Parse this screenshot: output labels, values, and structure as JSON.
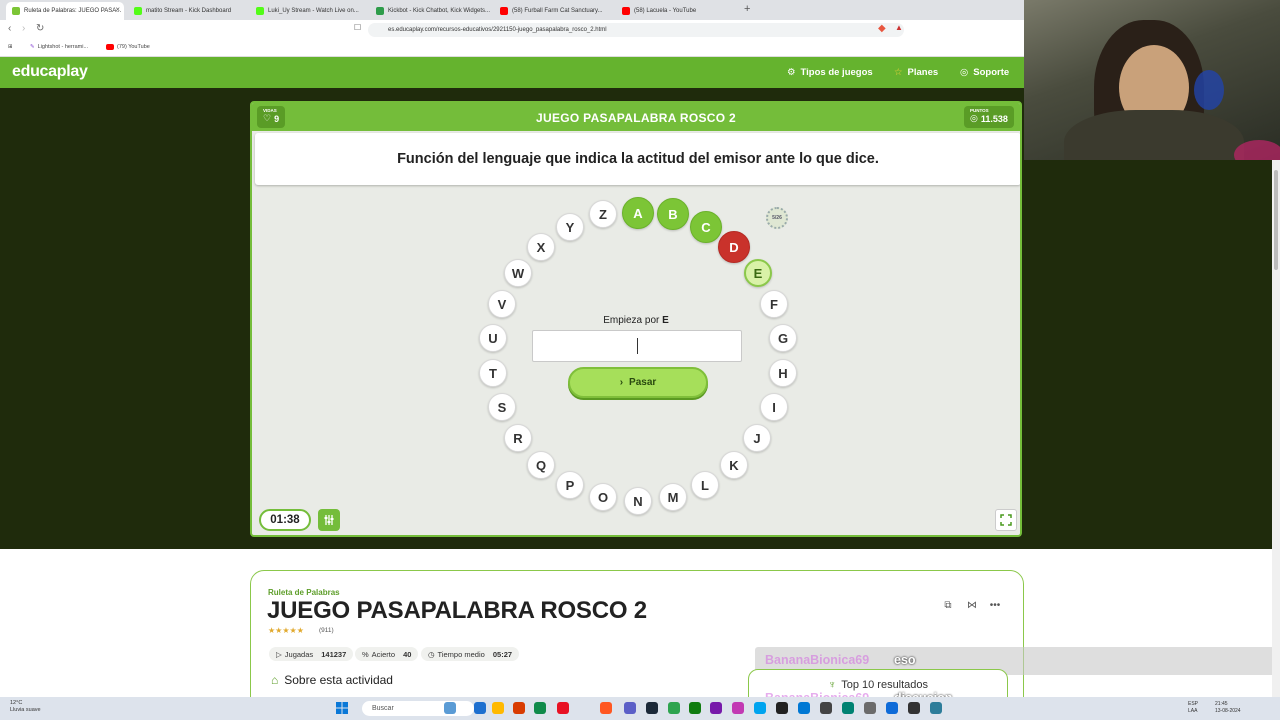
{
  "browser": {
    "tabs": [
      {
        "label": "Ruleta de Palabras: JUEGO PASA...",
        "active": true,
        "fav_color": "#7cc536"
      },
      {
        "label": "matito Stream - Kick Dashboard",
        "active": false,
        "fav_color": "#53fc18"
      },
      {
        "label": "Luki_Uy Stream - Watch Live on...",
        "active": false,
        "fav_color": "#53fc18"
      },
      {
        "label": "Kickbot - Kick Chatbot, Kick Widgets...",
        "active": false,
        "fav_color": "#2e9c4a"
      },
      {
        "label": "(58) Furball Farm Cat Sanctuary...",
        "active": false,
        "fav_color": "#ff0000"
      },
      {
        "label": "(58) Lacuela - YouTube",
        "active": false,
        "fav_color": "#ff0000"
      }
    ],
    "close_glyph": "×",
    "new_tab_glyph": "+",
    "url": "es.educaplay.com/recursos-educativos/2921150-juego_pasapalabra_rosco_2.html",
    "bookmarks": [
      "Lightshot - herrami...",
      "(79) YouTube"
    ]
  },
  "header": {
    "logo": "educaplay",
    "nav": [
      "Tipos de juegos",
      "Planes",
      "Soporte"
    ],
    "brand_color": "#65b32e"
  },
  "game": {
    "lives_label": "VIDAS",
    "lives": "9",
    "title": "JUEGO PASAPALABRA ROSCO 2",
    "points_label": "PUNTOS",
    "points": "11.538",
    "question": "Función del lenguaje que indica la actitud del emisor ante lo que dice.",
    "progress": "5/26",
    "prompt_text": "Empieza por",
    "prompt_letter": "E",
    "answer_value": "",
    "pass_label": "Pasar",
    "timer": "01:38",
    "letters": [
      {
        "letter": "A",
        "state": "correct"
      },
      {
        "letter": "B",
        "state": "correct"
      },
      {
        "letter": "C",
        "state": "correct"
      },
      {
        "letter": "D",
        "state": "wrong"
      },
      {
        "letter": "E",
        "state": "current"
      },
      {
        "letter": "F",
        "state": "pending"
      },
      {
        "letter": "G",
        "state": "pending"
      },
      {
        "letter": "H",
        "state": "pending"
      },
      {
        "letter": "I",
        "state": "pending"
      },
      {
        "letter": "J",
        "state": "pending"
      },
      {
        "letter": "K",
        "state": "pending"
      },
      {
        "letter": "L",
        "state": "pending"
      },
      {
        "letter": "M",
        "state": "pending"
      },
      {
        "letter": "N",
        "state": "pending"
      },
      {
        "letter": "O",
        "state": "pending"
      },
      {
        "letter": "P",
        "state": "pending"
      },
      {
        "letter": "Q",
        "state": "pending"
      },
      {
        "letter": "R",
        "state": "pending"
      },
      {
        "letter": "S",
        "state": "pending"
      },
      {
        "letter": "T",
        "state": "pending"
      },
      {
        "letter": "U",
        "state": "pending"
      },
      {
        "letter": "V",
        "state": "pending"
      },
      {
        "letter": "W",
        "state": "pending"
      },
      {
        "letter": "X",
        "state": "pending"
      },
      {
        "letter": "Y",
        "state": "pending"
      },
      {
        "letter": "Z",
        "state": "pending"
      }
    ]
  },
  "card": {
    "category": "Ruleta de Palabras",
    "title": "JUEGO PASAPALABRA ROSCO 2",
    "stars": "★★★★★",
    "rating_count": "(911)",
    "stats": [
      {
        "label": "Jugadas",
        "value": "141237"
      },
      {
        "label": "Acierto",
        "value": "40"
      },
      {
        "label": "Tiempo medio",
        "value": "05:27"
      }
    ],
    "about": "Sobre esta actividad"
  },
  "chat": {
    "messages": [
      {
        "user": "BananaBionica69",
        "text": "eso"
      },
      {
        "user": "BananaBionica69",
        "text": "discucion"
      }
    ],
    "top10": "Top 10 resultados"
  },
  "taskbar": {
    "weather_temp": "12°C",
    "weather_desc": "Lluvia suave",
    "search": "Buscar",
    "lang": "ESP",
    "lang2": "LAA",
    "time": "21:45",
    "date": "13-08-2024"
  }
}
